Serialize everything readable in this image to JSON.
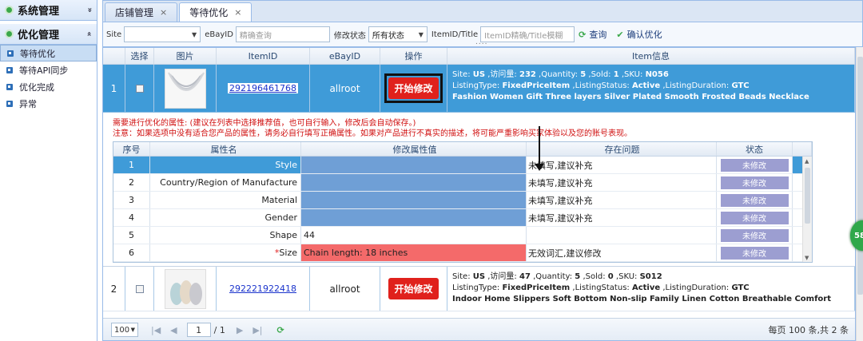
{
  "sidebar": {
    "section1": {
      "label": "系统管理",
      "toggle": "»"
    },
    "section2": {
      "label": "优化管理",
      "toggle": "»"
    },
    "items": [
      {
        "label": "等待优化",
        "active": true
      },
      {
        "label": "等待API同步"
      },
      {
        "label": "优化完成"
      },
      {
        "label": "异常"
      }
    ]
  },
  "tabs": [
    {
      "label": "店铺管理",
      "close": "×"
    },
    {
      "label": "等待优化",
      "close": "×",
      "active": true
    }
  ],
  "filter": {
    "site_label": "Site",
    "site_value": "",
    "ebayid_label": "eBayID",
    "ebayid_placeholder": "精确查询",
    "status_label": "修改状态",
    "status_value": "所有状态",
    "itemid_label": "ItemID/Title",
    "itemid_placeholder": "ItemID精确/Title模糊",
    "search_label": "查询",
    "confirm_label": "确认优化"
  },
  "grid": {
    "headers": [
      "",
      "选择",
      "图片",
      "ItemID",
      "eBayID",
      "操作",
      "Item信息"
    ],
    "rows": [
      {
        "no": "1",
        "item_id": "292196461768",
        "ebay_id": "allroot",
        "action": "开始修改",
        "info_line1_pre": "Site: ",
        "info_line1_site": "US",
        "info_line1_rest": " ,访问量: ",
        "info_line1_visits": "232",
        "info_line1_qty_label": " ,Quantity: ",
        "info_line1_qty": "5",
        "info_line1_sold_label": " ,Sold: ",
        "info_line1_sold": "1",
        "info_line1_sku_label": " ,SKU: ",
        "info_line1_sku": "N056",
        "info_line2_pre": "ListingType: ",
        "info_line2_type": "FixedPriceItem",
        "info_line2_status_label": " ,ListingStatus: ",
        "info_line2_status": "Active",
        "info_line2_dur_label": " ,ListingDuration: ",
        "info_line2_dur": "GTC",
        "title": "Fashion Women Gift Three layers Silver Plated Smooth Frosted Beads Necklace"
      },
      {
        "no": "2",
        "item_id": "292221922418",
        "ebay_id": "allroot",
        "action": "开始修改",
        "info_line1_pre": "Site: ",
        "info_line1_site": "US",
        "info_line1_rest": " ,访问量: ",
        "info_line1_visits": "47",
        "info_line1_qty_label": " ,Quantity: ",
        "info_line1_qty": "5",
        "info_line1_sold_label": " ,Sold: ",
        "info_line1_sold": "0",
        "info_line1_sku_label": " ,SKU: ",
        "info_line1_sku": "S012",
        "info_line2_pre": "ListingType: ",
        "info_line2_type": "FixedPriceItem",
        "info_line2_status_label": " ,ListingStatus: ",
        "info_line2_status": "Active",
        "info_line2_dur_label": " ,ListingDuration: ",
        "info_line2_dur": "GTC",
        "title": "Indoor Home Slippers Soft Bottom Non-slip Family Linen Cotton Breathable Comfort"
      }
    ]
  },
  "detail": {
    "note1": "需要进行优化的属性: (建议在列表中选择推荐值，也可自行输入，修改后会自动保存。)",
    "note2": "注意：如果选项中没有适合您产品的属性，请务必自行填写正确属性。如果对产品进行不真实的描述，将可能严重影响买家体验以及您的账号表现。",
    "headers": [
      "序号",
      "属性名",
      "修改属性值",
      "存在问题",
      "状态"
    ],
    "rows": [
      {
        "no": "1",
        "name": "Style",
        "value": "",
        "problem": "未填写,建议补充",
        "status": "未修改"
      },
      {
        "no": "2",
        "name": "Country/Region of Manufacture",
        "value": "",
        "problem": "未填写,建议补充",
        "status": "未修改"
      },
      {
        "no": "3",
        "name": "Material",
        "value": "",
        "problem": "未填写,建议补充",
        "status": "未修改"
      },
      {
        "no": "4",
        "name": "Gender",
        "value": "",
        "problem": "未填写,建议补充",
        "status": "未修改"
      },
      {
        "no": "5",
        "name": "Shape",
        "value": "44",
        "problem": "",
        "status": "未修改"
      },
      {
        "no": "6",
        "name_prefix": "*",
        "name": "Size",
        "value": "Chain length: 18 inches",
        "problem": "无效词汇,建议修改",
        "status": "未修改"
      }
    ]
  },
  "pager": {
    "page_size": "100",
    "page": "1",
    "total_pages": "/ 1",
    "summary": "每页 100 条,共 2 条"
  },
  "badge": "58"
}
